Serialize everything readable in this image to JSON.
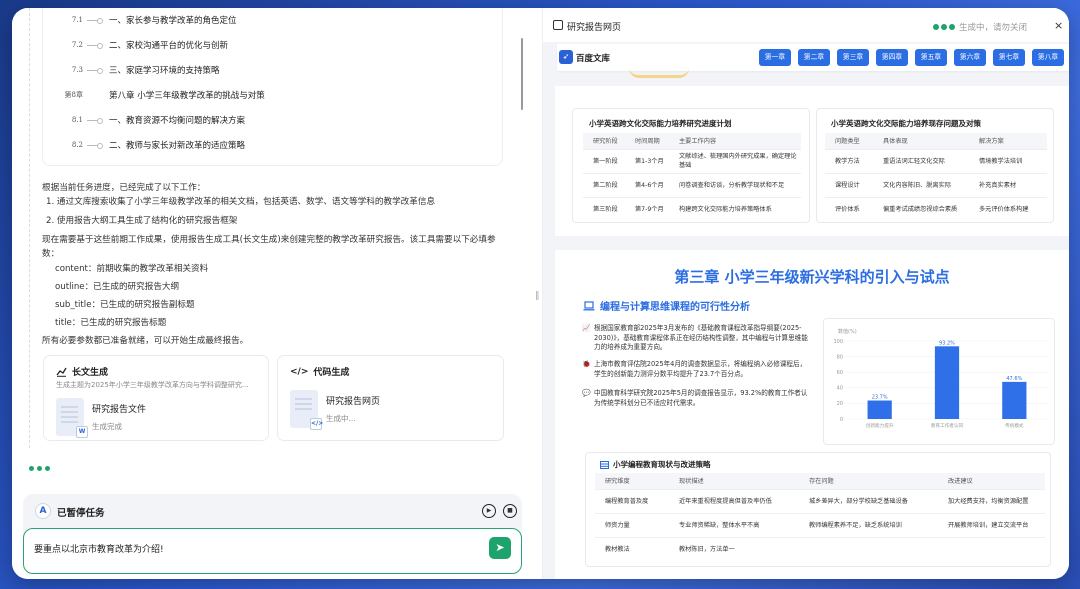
{
  "toc": {
    "rows": [
      {
        "num": "7.1",
        "text": "一、家长参与教学改革的角色定位"
      },
      {
        "num": "7.2",
        "text": "二、家校沟通平台的优化与创新"
      },
      {
        "num": "7.3",
        "text": "三、家庭学习环境的支持策略"
      },
      {
        "num": "第8章",
        "text": "第八章 小学三年级教学改革的挑战与对策"
      },
      {
        "num": "8.1",
        "text": "一、教育资源不均衡问题的解决方案"
      },
      {
        "num": "8.2",
        "text": "二、教师与家长对新改革的适应策略"
      }
    ]
  },
  "chat": {
    "progress_intro": "根据当前任务进度，已经完成了以下工作：",
    "done_1": "1. 通过文库搜索收集了小学三年级教学改革的相关文档，包括英语、数学、语文等学科的教学改革信息",
    "done_2": "2. 使用报告大纲工具生成了结构化的研究报告框架",
    "next_1": "现在需要基于这些前期工作成果，使用报告生成工具(长文生成)来创建完整的教学改革研究报告。该工具需要以下必填参",
    "next_2": "数：",
    "param_content": "content：前期收集的教学改革相关资料",
    "param_outline": "outline：已生成的研究报告大纲",
    "param_subtitle": "sub_title：已生成的研究报告副标题",
    "param_title": "title：已生成的研究报告标题",
    "ready": "所有必要参数都已准备就绪，可以开始生成最终报告。"
  },
  "cards": {
    "longtext": {
      "title": "长文生成",
      "subtitle": "生成主题为2025年小学三年级教学改革方向与学科调整研究...",
      "file_name": "研究报告文件",
      "file_state": "生成完成",
      "icon": "chart-line-icon"
    },
    "code": {
      "title": "代码生成",
      "file_name": "研究报告网页",
      "file_state": "生成中...",
      "icon": "code-icon"
    }
  },
  "task": {
    "title": "已暂停任务",
    "input_value": "要重点以北京市教育改革为介绍!",
    "send_icon": "send-icon"
  },
  "preview": {
    "title": "研究报告网页",
    "status": "生成中，请勿关闭",
    "close": "×",
    "nav": {
      "brand": "百度文库",
      "buttons": [
        "第一章",
        "第二章",
        "第三章",
        "第四章",
        "第五章",
        "第六章",
        "第七章",
        "第八章"
      ]
    },
    "plan_table": {
      "title": "小学英语跨文化交际能力培养研究进度计划",
      "headers": [
        "研究阶段",
        "时间周期",
        "主要工作内容"
      ],
      "rows": [
        [
          "第一阶段",
          "第1-3个月",
          "文献综述、梳理国内外研究成果，确定理论基础"
        ],
        [
          "第二阶段",
          "第4-6个月",
          "问卷调查和访谈，分析教学现状和不足"
        ],
        [
          "第三阶段",
          "第7-9个月",
          "构建跨文化交际能力培养策略体系"
        ]
      ]
    },
    "problem_table": {
      "title": "小学英语跨文化交际能力培养现存问题及对策",
      "headers": [
        "问题类型",
        "具体表现",
        "解决方案"
      ],
      "rows": [
        [
          "教学方法",
          "重语法词汇轻文化交际",
          "情境教学法培训"
        ],
        [
          "课程设计",
          "文化内容陈旧、脱离实际",
          "补充真实素材"
        ],
        [
          "评价体系",
          "偏重考试成绩忽视综合素质",
          "多元评价体系构建"
        ]
      ]
    },
    "chapter3": {
      "title": "第三章 小学三年级新兴学科的引入与试点",
      "section_title": "编程与计算思维课程的可行性分析",
      "bullets": [
        {
          "icon": "trend-icon",
          "lines": [
            "根据国家教育部2025年3月发布的《基础教育课程改革指导纲要(2025-",
            "2030)》，基础教育课程体系正在经历结构性调整，其中编程与计算思维能",
            "力的培养成为重要方向。"
          ]
        },
        {
          "icon": "bug-icon",
          "lines": [
            "上海市教育评估院2025年4月的调查数据显示，将编程纳入必修课程后，",
            "学生的创新能力测评分数平均提升了23.7个百分点。"
          ]
        },
        {
          "icon": "chat-icon",
          "lines": [
            "中国教育科学研究院2025年5月的调查报告显示，93.2%的教育工作者认",
            "为传统学科划分已不适应时代需求。"
          ]
        }
      ],
      "strategy_table": {
        "title": "小学编程教育现状与改进策略",
        "headers": [
          "研究维度",
          "现状描述",
          "存在问题",
          "改进建议"
        ],
        "rows": [
          [
            "编程教育普及度",
            "近年来重视程度提高但普及率仍低",
            "城乡差异大，部分学校缺乏基础设备",
            "加大经费支持，均衡资源配置"
          ],
          [
            "师资力量",
            "专业师资稀缺，整体水平不高",
            "教师编程素养不足，缺乏系统培训",
            "开展教师培训，建立交流平台"
          ],
          [
            "教材教法",
            "教材陈旧，方法单一",
            "",
            ""
          ]
        ]
      }
    }
  },
  "chart_data": {
    "type": "bar",
    "categories": [
      "创新能力提升",
      "教育工作者认同",
      "传统模式"
    ],
    "values": [
      23.7,
      93.2,
      47.6
    ],
    "value_labels": [
      "23.7%",
      "93.2%",
      "47.6%"
    ],
    "ylabel": "数值(%)",
    "ylim": [
      0,
      100
    ],
    "yticks": [
      0,
      20,
      40,
      60,
      80,
      100
    ],
    "colors": [
      "#2f6fe8",
      "#2f6fe8",
      "#2f6fe8"
    ]
  },
  "colors": {
    "accent": "#2b6de3",
    "green": "#1fa36d"
  }
}
